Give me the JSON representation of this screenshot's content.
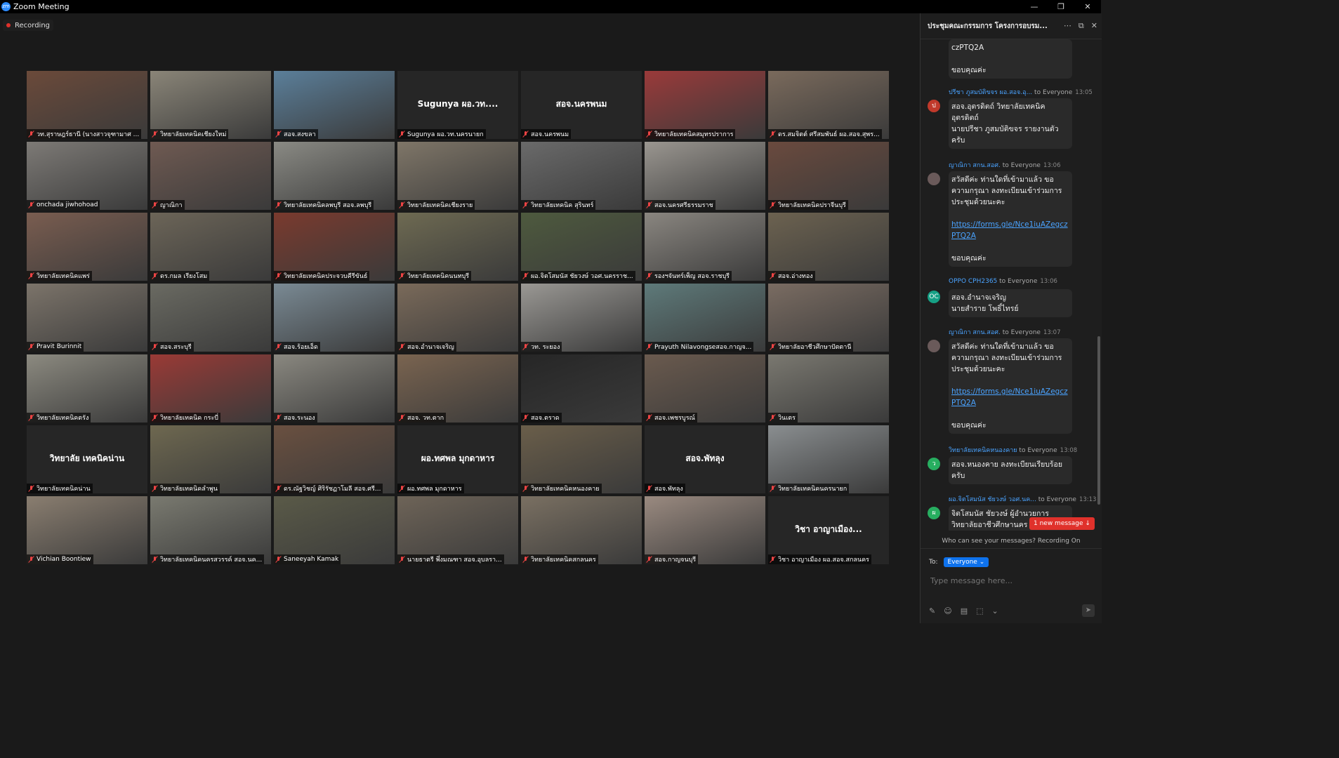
{
  "window": {
    "title": "Zoom Meeting",
    "logo": "zm"
  },
  "recording": {
    "label": "Recording"
  },
  "tiles": [
    {
      "name": "วท.สุราษฎร์ธานี (นางสาวจุฑามาศ ...",
      "big": "",
      "bg": "#6b4a3a"
    },
    {
      "name": "วิทยาลัยเทคนิคเชียงใหม่",
      "big": "",
      "bg": "#8a8578"
    },
    {
      "name": "สอจ.สงขลา",
      "big": "",
      "bg": "#5b7f9a"
    },
    {
      "name": "Sugunya ผอ.วท.นครนายก",
      "big": "Sugunya ผอ.วท....",
      "bg": "#262626"
    },
    {
      "name": "สอจ.นครพนม",
      "big": "สอจ.นครพนม",
      "bg": "#262626"
    },
    {
      "name": "วิทยาลัยเทคนิคสมุทรปราการ",
      "big": "",
      "bg": "#9a3a3a"
    },
    {
      "name": "ดร.สมจิตต์ ศรีสมพันธ์ ผอ.สอจ.สุพร...",
      "big": "",
      "bg": "#7a6a5c"
    },
    {
      "name": "onchada jiwhohoad",
      "big": "",
      "bg": "#7d7a76"
    },
    {
      "name": "ญาณิกา",
      "big": "",
      "bg": "#6f5a52",
      "active": true
    },
    {
      "name": "วิทยาลัยเทคนิคลพบุรี สอจ.ลพบุรี",
      "big": "",
      "bg": "#8a8a84"
    },
    {
      "name": "วิทยาลัยเทคนิคเชียงราย",
      "big": "",
      "bg": "#7f7668"
    },
    {
      "name": "วิทยาลัยเทคนิค สุรินทร์",
      "big": "",
      "bg": "#6a6a6a"
    },
    {
      "name": "สอจ.นครศรีธรรมราช",
      "big": "",
      "bg": "#9a9690"
    },
    {
      "name": "วิทยาลัยเทคนิคปราจีนบุรี",
      "big": "",
      "bg": "#6a4a3e"
    },
    {
      "name": "วิทยาลัยเทคนิคแพร่",
      "big": "",
      "bg": "#7a5d50"
    },
    {
      "name": "ดร.กมล เรียงโสม",
      "big": "",
      "bg": "#6c6558"
    },
    {
      "name": "วิทยาลัยเทคนิคประจวบคีรีขันธ์",
      "big": "",
      "bg": "#7a3a2e"
    },
    {
      "name": "วิทยาลัยเทคนิคนนทบุรี",
      "big": "",
      "bg": "#6e6a52"
    },
    {
      "name": "ผอ.จิตโสมนัส ชัยวงษ์ วอศ.นครราช...",
      "big": "",
      "bg": "#4e5a3e"
    },
    {
      "name": "รองฯจันทร์เพ็ญ สอจ.ราชบุรี",
      "big": "",
      "bg": "#8a8680"
    },
    {
      "name": "สอจ.อ่างทอง",
      "big": "",
      "bg": "#6c6250"
    },
    {
      "name": "Pravit Burinnit",
      "big": "",
      "bg": "#7c746a"
    },
    {
      "name": "สอจ.สระบุรี",
      "big": "",
      "bg": "#6a6a62"
    },
    {
      "name": "สอจ.ร้อยเอ็ด",
      "big": "",
      "bg": "#7a8a94"
    },
    {
      "name": "สอจ.อำนาจเจริญ",
      "big": "",
      "bg": "#7a6a5a"
    },
    {
      "name": "วท. ระยอง",
      "big": "",
      "bg": "#9a9894"
    },
    {
      "name": "Prayuth Nilavongseสอจ.กาญจ...",
      "big": "",
      "bg": "#5e7a7a"
    },
    {
      "name": "วิทยาลัยอาชีวศึกษาปัตตานี",
      "big": "",
      "bg": "#7a6c62"
    },
    {
      "name": "วิทยาลัยเทคนิคตรัง",
      "big": "",
      "bg": "#8c8a80"
    },
    {
      "name": "วิทยาลัยเทคนิค กระบี่",
      "big": "",
      "bg": "#9a3a36"
    },
    {
      "name": "สอจ.ระนอง",
      "big": "",
      "bg": "#8a8880"
    },
    {
      "name": "สอจ. วท.ตาก",
      "big": "",
      "bg": "#7a6450"
    },
    {
      "name": "สอจ.ตราด",
      "big": "",
      "bg": "#262626"
    },
    {
      "name": "สอจ.เพชรบูรณ์",
      "big": "",
      "bg": "#6a5a4e"
    },
    {
      "name": "วินเตร",
      "big": "",
      "bg": "#7a7870"
    },
    {
      "name": "วิทยาลัยเทคนิคน่าน",
      "big": "วิทยาลัย เทคนิคน่าน",
      "bg": "#262626"
    },
    {
      "name": "วิทยาลัยเทคนิคลำพูน",
      "big": "",
      "bg": "#6e6850"
    },
    {
      "name": "ดร.ณัฐวิชญ์ ศิริรัชฏาโมลี สอจ.ศรี...",
      "big": "",
      "bg": "#6a5040"
    },
    {
      "name": "ผอ.ทศพล มุกดาหาร",
      "big": "ผอ.ทศพล มุกดาหาร",
      "bg": "#262626"
    },
    {
      "name": "วิทยาลัยเทคนิคหนองคาย",
      "big": "",
      "bg": "#6a5e4a"
    },
    {
      "name": "สอจ.พัทลุง",
      "big": "สอจ.พัทลุง",
      "bg": "#262626"
    },
    {
      "name": "วิทยาลัยเทคนิคนครนายก",
      "big": "",
      "bg": "#8a8e90"
    },
    {
      "name": "Vichian Boontiew",
      "big": "",
      "bg": "#8a7e70"
    },
    {
      "name": "วิทยาลัยเทคนิคนครสวรรค์ สอจ.นค...",
      "big": "",
      "bg": "#7a7a70"
    },
    {
      "name": "Saneeyah Kamak",
      "big": "",
      "bg": "#5a5a48"
    },
    {
      "name": "นายธาตรี พึ่งมณฑา สอจ.อุบลรา...",
      "big": "",
      "bg": "#6e6458"
    },
    {
      "name": "วิทยาลัยเทคนิคสกลนคร",
      "big": "",
      "bg": "#7a7062"
    },
    {
      "name": "สอจ.กาญจนบุรี",
      "big": "",
      "bg": "#9a8a80"
    },
    {
      "name": "วิชา อาญาเมือง ผอ.สอจ.สกลนคร",
      "big": "วิชา อาญาเมือง...",
      "bg": "#262626"
    }
  ],
  "chat": {
    "title": "ประชุมคณะกรรมการ โครงการอบรม...",
    "header_icons": [
      "more-icon",
      "popout-icon",
      "close-icon"
    ],
    "messages": [
      {
        "sender": "",
        "to": "",
        "time": "",
        "avatar": "",
        "avatar_color": "",
        "lines": [
          "czPTQ2A",
          "",
          "ขอบคุณค่ะ"
        ]
      },
      {
        "sender": "ปรีชา ภูสมบัติขจร ผอ.สอจ.อุ...",
        "to": "to Everyone",
        "time": "13:05",
        "avatar": "ป",
        "avatar_color": "#c0392b",
        "lines": [
          "สอจ.อุตรดิตถ์ วิทยาลัยเทคนิคอุตรดิตถ์",
          "นายปรีชา ภูสมบัติขจร รายงานตัวครับ"
        ]
      },
      {
        "sender": "ญาณิกา สกน.สอศ.",
        "to": "to Everyone",
        "time": "13:06",
        "avatar": "",
        "avatar_color": "#6a5a5a",
        "lines": [
          "สวัสดีค่ะ ท่านใดที่เข้ามาแล้ว ขอความกรุณา ลงทะเบียนเข้าร่วมการประชุมด้วยนะคะ"
        ],
        "link": "https://forms.gle/Nce1iuAZegczPTQ2A",
        "after": "ขอบคุณค่ะ"
      },
      {
        "sender": "OPPO CPH2365",
        "to": "to Everyone",
        "time": "13:06",
        "avatar": "OC",
        "avatar_color": "#16a085",
        "lines": [
          "สอจ.อำนาจเจริญ",
          "นายสำราย โพธิ์ไทรย์"
        ]
      },
      {
        "sender": "ญาณิกา สกน.สอศ.",
        "to": "to Everyone",
        "time": "13:07",
        "avatar": "",
        "avatar_color": "#6a5a5a",
        "lines": [
          "สวัสดีค่ะ ท่านใดที่เข้ามาแล้ว ขอความกรุณา ลงทะเบียนเข้าร่วมการประชุมด้วยนะคะ"
        ],
        "link": "https://forms.gle/Nce1iuAZegczPTQ2A",
        "after": "ขอบคุณค่ะ"
      },
      {
        "sender": "วิทยาลัยเทคนิคหนองคาย",
        "to": "to Everyone",
        "time": "13:08",
        "avatar": "ว",
        "avatar_color": "#27ae60",
        "lines": [
          "สอจ.หนองคาย ลงทะเบียนเรียบร้อยครับ"
        ]
      },
      {
        "sender": "ผอ.จิตโสมนัส ชัยวงษ์ วอศ.นค...",
        "to": "to Everyone",
        "time": "13:13",
        "avatar": "ผ",
        "avatar_color": "#27ae60",
        "lines": [
          "จิตโสมนัส ชัยวงษ์ ผู้อำนวยการ",
          "วิทยาลัยอาชีวศึกษานคร"
        ]
      }
    ],
    "new_message": "1 new message ↓",
    "privacy_note": "Who can see your messages? Recording On",
    "to_label": "To:",
    "to_value": "Everyone",
    "input_placeholder": "Type message here...",
    "colors": {
      "accent": "#0e72ed",
      "link": "#4aa3ff",
      "alert": "#e0312b",
      "active_speaker": "#e8e25a"
    }
  }
}
